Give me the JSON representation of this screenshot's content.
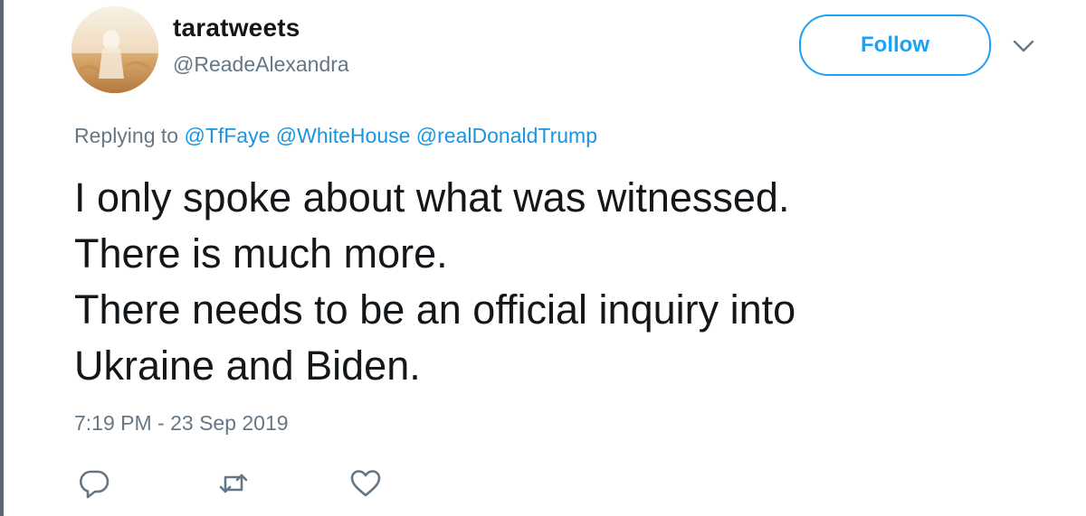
{
  "tweet": {
    "author": {
      "display_name": "taratweets",
      "handle": "@ReadeAlexandra",
      "avatar_icon": "profile-photo"
    },
    "follow_label": "Follow",
    "menu_icon": "chevron-down-icon",
    "replying": {
      "prefix": "Replying to",
      "mentions": [
        "@TfFaye",
        "@WhiteHouse",
        "@realDonaldTrump"
      ]
    },
    "text": "I only spoke about what was witnessed.\nThere is much more.\nThere needs to be an official inquiry into\nUkraine and Biden.",
    "timestamp": "7:19 PM - 23 Sep 2019",
    "actions": [
      "reply-icon",
      "retweet-icon",
      "like-icon"
    ]
  },
  "colors": {
    "accent": "#1da1f2",
    "mention": "#1b95e0",
    "text_primary": "#14171a",
    "text_secondary": "#657786",
    "icon": "#657786"
  }
}
